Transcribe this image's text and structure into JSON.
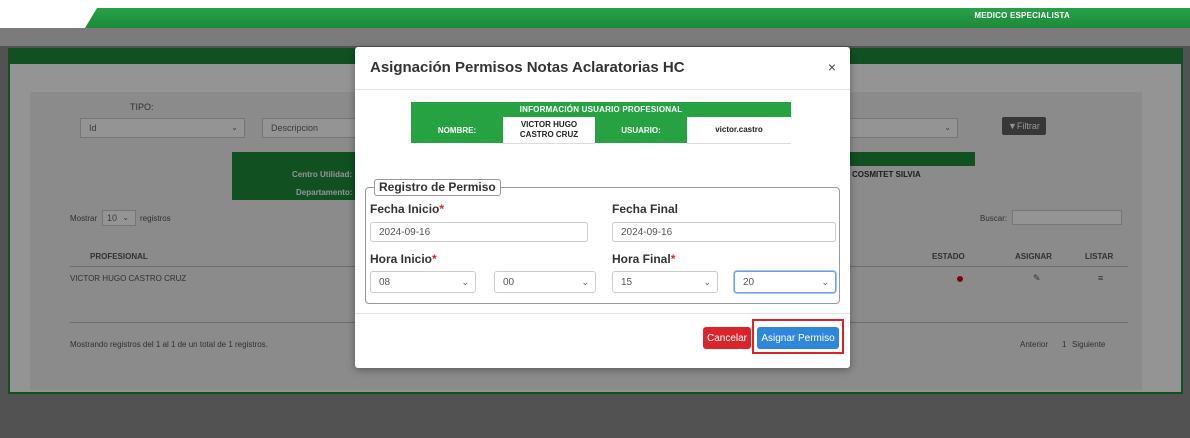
{
  "header": {
    "role": "MEDICO ESPECIALISTA"
  },
  "filters": {
    "tipo_label": "TIPO:",
    "tipo_value": "Id",
    "descripcion_placeholder": "Descripcion",
    "filter_button": "Filtrar"
  },
  "bg_info": {
    "centro_utilidad_label": "Centro Utilidad:",
    "departamento_label": "Departamento:",
    "centro_value": "COSMITET SILVIA"
  },
  "table": {
    "mostrar": "Mostrar",
    "page_size": "10",
    "registros": "registros",
    "buscar": "Buscar:",
    "headers": [
      "PROFESIONAL",
      "ESTADO",
      "ASIGNAR",
      "LISTAR"
    ],
    "rows": [
      {
        "profesional": "VICTOR HUGO CASTRO CRUZ"
      }
    ],
    "footer": "Mostrando registros del 1 al 1 de un total de 1 registros.",
    "pager": [
      "Anterior",
      "1",
      "Siguiente"
    ]
  },
  "modal": {
    "title": "Asignación Permisos Notas Aclaratorias HC",
    "close": "×",
    "info": {
      "heading": "INFORMACIÓN USUARIO PROFESIONAL",
      "nombre_label": "NOMBRE:",
      "nombre_value": "VICTOR HUGO CASTRO CRUZ",
      "usuario_label": "USUARIO:",
      "usuario_value": "victor.castro"
    },
    "form": {
      "legend": "Registro de Permiso",
      "fecha_inicio_label": "Fecha Inicio",
      "fecha_inicio_value": "2024-09-16",
      "fecha_final_label": "Fecha Final",
      "fecha_final_value": "2024-09-16",
      "hora_inicio_label": "Hora Inicio",
      "hora_inicio_h": "08",
      "hora_inicio_m": "00",
      "hora_final_label": "Hora Final",
      "hora_final_h": "15",
      "hora_final_m": "20",
      "required_mark": "*"
    },
    "buttons": {
      "cancel": "Cancelar",
      "assign": "Asignar Permiso"
    }
  },
  "colors": {
    "green": "#27a243",
    "red": "#d9242b",
    "blue": "#2f87d9"
  }
}
